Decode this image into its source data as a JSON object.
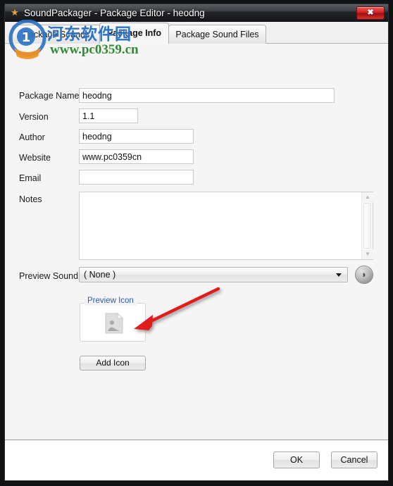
{
  "window": {
    "title": "SoundPackager - Package Editor - heodng",
    "app_icon": "application-icon",
    "close_label": "✖"
  },
  "tabs": [
    {
      "label": "Package Sounds",
      "active": false
    },
    {
      "label": "Package Info",
      "active": true
    },
    {
      "label": "Package Sound Files",
      "active": false
    }
  ],
  "form": {
    "package_name": {
      "label": "Package Name",
      "value": "heodng",
      "placeholder": ""
    },
    "version": {
      "label": "Version",
      "value": "1.1",
      "placeholder": ""
    },
    "author": {
      "label": "Author",
      "value": "heodng",
      "placeholder": ""
    },
    "website": {
      "label": "Website",
      "value": "www.pc0359cn",
      "placeholder": ""
    },
    "email": {
      "label": "Email",
      "value": "",
      "placeholder": ""
    },
    "notes": {
      "label": "Notes",
      "value": "",
      "placeholder": ""
    },
    "preview_sound": {
      "label": "Preview Sound",
      "value": "( None )",
      "options": [
        "( None )"
      ]
    },
    "play_button_glyph": "◗"
  },
  "preview_icon": {
    "legend": "Preview Icon",
    "add_button_label": "Add Icon"
  },
  "annotation": {
    "color": "#e01b1b"
  },
  "footer": {
    "ok_label": "OK",
    "cancel_label": "Cancel"
  },
  "watermark": {
    "cjk_text": "河东软件园",
    "url_text": "www.pc0359.cn",
    "logo_digit": "1",
    "blue": "#2c73c6",
    "green": "#2e8b32",
    "orange": "#f0901e"
  },
  "colors": {
    "body_bg": "#f5f5f5",
    "accent_blue": "#2a5db0",
    "close_red": "#cf2020"
  }
}
